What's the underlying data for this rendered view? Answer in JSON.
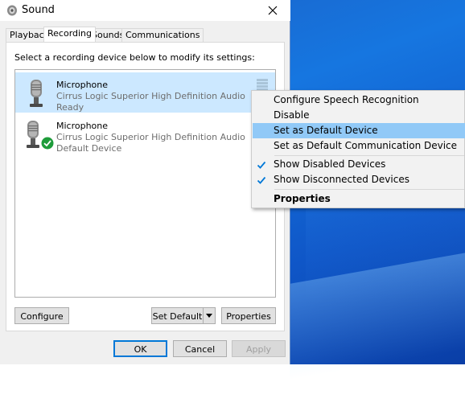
{
  "window": {
    "title": "Sound"
  },
  "tabs": [
    {
      "label": "Playback"
    },
    {
      "label": "Recording"
    },
    {
      "label": "Sounds"
    },
    {
      "label": "Communications"
    }
  ],
  "instructions": "Select a recording device below to modify its settings:",
  "devices": [
    {
      "name": "Microphone",
      "driver": "Cirrus Logic Superior High Definition Audio",
      "status": "Ready",
      "selected": true
    },
    {
      "name": "Microphone",
      "driver": "Cirrus Logic Superior High Definition Audio",
      "status": "Default Device",
      "default_badge": true
    }
  ],
  "buttons": {
    "configure": "Configure",
    "set_default": "Set Default",
    "properties": "Properties",
    "ok": "OK",
    "cancel": "Cancel",
    "apply": "Apply"
  },
  "context_menu": {
    "items": [
      {
        "label": "Configure Speech Recognition"
      },
      {
        "label": "Disable"
      },
      {
        "label": "Set as Default Device",
        "highlighted": true
      },
      {
        "label": "Set as Default Communication Device"
      },
      {
        "label": "Show Disabled Devices",
        "checked": true
      },
      {
        "label": "Show Disconnected Devices",
        "checked": true
      },
      {
        "label": "Properties",
        "bold": true
      }
    ]
  },
  "colors": {
    "selection": "#cce8ff",
    "menu_highlight": "#91c9f7",
    "accent": "#0078d7",
    "desktop": "#1676e0"
  }
}
